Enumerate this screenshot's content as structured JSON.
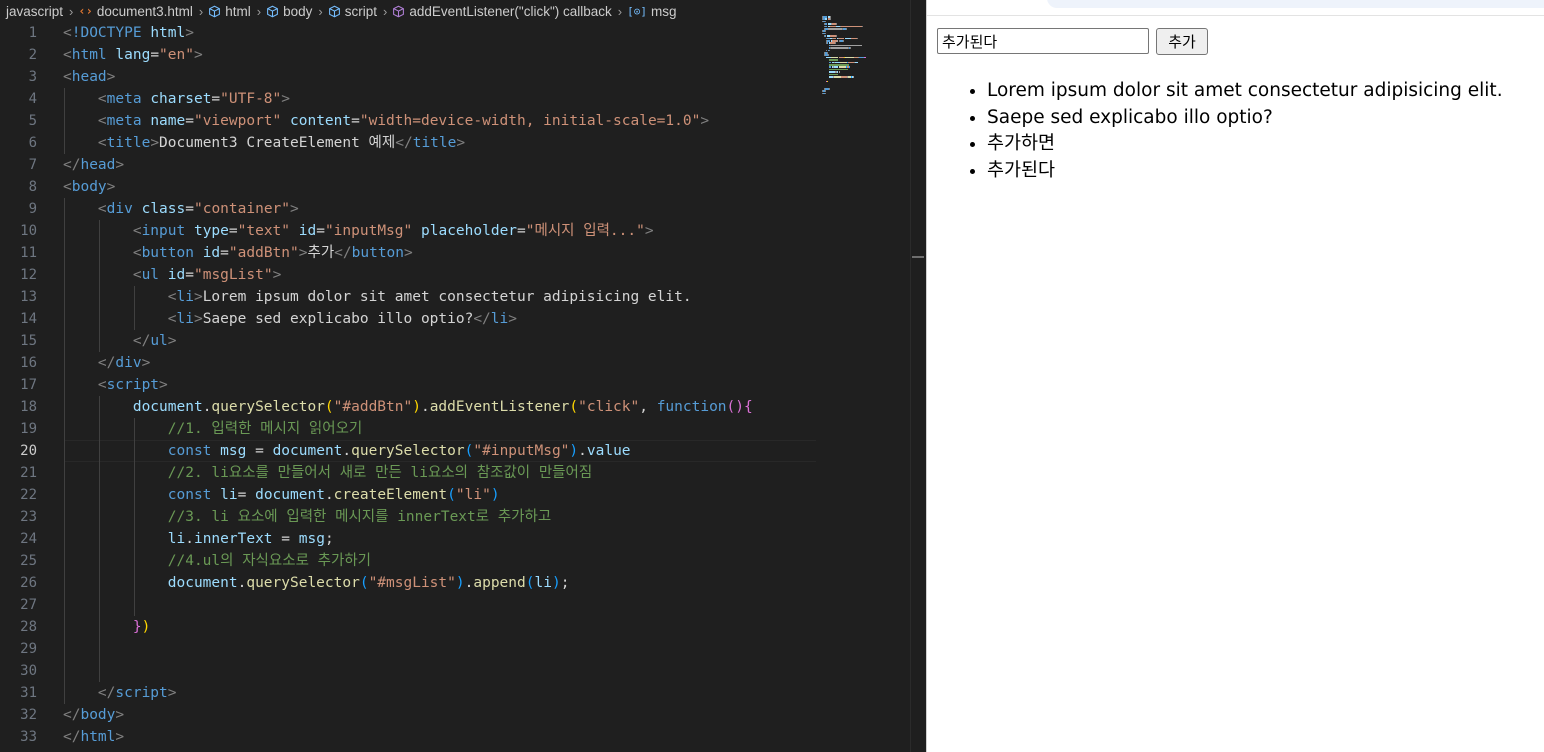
{
  "breadcrumb": {
    "items": [
      "javascript",
      "document3.html",
      "html",
      "body",
      "script",
      "addEventListener(\"click\") callback",
      "msg"
    ]
  },
  "editor": {
    "current_line": 20,
    "lines": [
      [
        [
          "<",
          "br"
        ],
        [
          "!DOCTYPE",
          "tag"
        ],
        [
          " ",
          "txt"
        ],
        [
          "html",
          "at"
        ],
        [
          ">",
          "br"
        ]
      ],
      [
        [
          "<",
          "br"
        ],
        [
          "html",
          "tag"
        ],
        [
          " ",
          "txt"
        ],
        [
          "lang",
          "at"
        ],
        [
          "=",
          "txt"
        ],
        [
          "\"en\"",
          "str"
        ],
        [
          ">",
          "br"
        ]
      ],
      [
        [
          "<",
          "br"
        ],
        [
          "head",
          "tag"
        ],
        [
          ">",
          "br"
        ]
      ],
      [
        [
          "    ",
          "txt"
        ],
        [
          "<",
          "br"
        ],
        [
          "meta",
          "tag"
        ],
        [
          " ",
          "txt"
        ],
        [
          "charset",
          "at"
        ],
        [
          "=",
          "txt"
        ],
        [
          "\"UTF-8\"",
          "str"
        ],
        [
          ">",
          "br"
        ]
      ],
      [
        [
          "    ",
          "txt"
        ],
        [
          "<",
          "br"
        ],
        [
          "meta",
          "tag"
        ],
        [
          " ",
          "txt"
        ],
        [
          "name",
          "at"
        ],
        [
          "=",
          "txt"
        ],
        [
          "\"viewport\"",
          "str"
        ],
        [
          " ",
          "txt"
        ],
        [
          "content",
          "at"
        ],
        [
          "=",
          "txt"
        ],
        [
          "\"width=device-width, initial-scale=1.0\"",
          "str"
        ],
        [
          ">",
          "br"
        ]
      ],
      [
        [
          "    ",
          "txt"
        ],
        [
          "<",
          "br"
        ],
        [
          "title",
          "tag"
        ],
        [
          ">",
          "br"
        ],
        [
          "Document3 CreateElement 예제",
          "txt"
        ],
        [
          "</",
          "br"
        ],
        [
          "title",
          "tag"
        ],
        [
          ">",
          "br"
        ]
      ],
      [
        [
          "</",
          "br"
        ],
        [
          "head",
          "tag"
        ],
        [
          ">",
          "br"
        ]
      ],
      [
        [
          "<",
          "br"
        ],
        [
          "body",
          "tag"
        ],
        [
          ">",
          "br"
        ]
      ],
      [
        [
          "    ",
          "txt"
        ],
        [
          "<",
          "br"
        ],
        [
          "div",
          "tag"
        ],
        [
          " ",
          "txt"
        ],
        [
          "class",
          "at"
        ],
        [
          "=",
          "txt"
        ],
        [
          "\"container\"",
          "str"
        ],
        [
          ">",
          "br"
        ]
      ],
      [
        [
          "        ",
          "txt"
        ],
        [
          "<",
          "br"
        ],
        [
          "input",
          "tag"
        ],
        [
          " ",
          "txt"
        ],
        [
          "type",
          "at"
        ],
        [
          "=",
          "txt"
        ],
        [
          "\"text\"",
          "str"
        ],
        [
          " ",
          "txt"
        ],
        [
          "id",
          "at"
        ],
        [
          "=",
          "txt"
        ],
        [
          "\"inputMsg\"",
          "str"
        ],
        [
          " ",
          "txt"
        ],
        [
          "placeholder",
          "at"
        ],
        [
          "=",
          "txt"
        ],
        [
          "\"메시지 입력...\"",
          "str"
        ],
        [
          ">",
          "br"
        ]
      ],
      [
        [
          "        ",
          "txt"
        ],
        [
          "<",
          "br"
        ],
        [
          "button",
          "tag"
        ],
        [
          " ",
          "txt"
        ],
        [
          "id",
          "at"
        ],
        [
          "=",
          "txt"
        ],
        [
          "\"addBtn\"",
          "str"
        ],
        [
          ">",
          "br"
        ],
        [
          "추가",
          "txt"
        ],
        [
          "</",
          "br"
        ],
        [
          "button",
          "tag"
        ],
        [
          ">",
          "br"
        ]
      ],
      [
        [
          "        ",
          "txt"
        ],
        [
          "<",
          "br"
        ],
        [
          "ul",
          "tag"
        ],
        [
          " ",
          "txt"
        ],
        [
          "id",
          "at"
        ],
        [
          "=",
          "txt"
        ],
        [
          "\"msgList\"",
          "str"
        ],
        [
          ">",
          "br"
        ]
      ],
      [
        [
          "            ",
          "txt"
        ],
        [
          "<",
          "br"
        ],
        [
          "li",
          "tag"
        ],
        [
          ">",
          "br"
        ],
        [
          "Lorem ipsum dolor sit amet consectetur adipisicing elit.",
          "txt"
        ]
      ],
      [
        [
          "            ",
          "txt"
        ],
        [
          "<",
          "br"
        ],
        [
          "li",
          "tag"
        ],
        [
          ">",
          "br"
        ],
        [
          "Saepe sed explicabo illo optio?",
          "txt"
        ],
        [
          "</",
          "br"
        ],
        [
          "li",
          "tag"
        ],
        [
          ">",
          "br"
        ]
      ],
      [
        [
          "        ",
          "txt"
        ],
        [
          "</",
          "br"
        ],
        [
          "ul",
          "tag"
        ],
        [
          ">",
          "br"
        ]
      ],
      [
        [
          "    ",
          "txt"
        ],
        [
          "</",
          "br"
        ],
        [
          "div",
          "tag"
        ],
        [
          ">",
          "br"
        ]
      ],
      [
        [
          "    ",
          "txt"
        ],
        [
          "<",
          "br"
        ],
        [
          "script",
          "tag"
        ],
        [
          ">",
          "br"
        ]
      ],
      [
        [
          "        ",
          "txt"
        ],
        [
          "document",
          "var"
        ],
        [
          ".",
          "pn"
        ],
        [
          "querySelector",
          "fn"
        ],
        [
          "(",
          "b1"
        ],
        [
          "\"#addBtn\"",
          "str"
        ],
        [
          ")",
          "b1"
        ],
        [
          ".",
          "pn"
        ],
        [
          "addEventListener",
          "fn"
        ],
        [
          "(",
          "b1"
        ],
        [
          "\"click\"",
          "str"
        ],
        [
          ", ",
          "pn"
        ],
        [
          "function",
          "kw"
        ],
        [
          "()",
          "b2"
        ],
        [
          "{",
          "b2"
        ]
      ],
      [
        [
          "            ",
          "txt"
        ],
        [
          "//1. 입력한 메시지 읽어오기",
          "cm"
        ]
      ],
      [
        [
          "            ",
          "txt"
        ],
        [
          "const",
          "kw"
        ],
        [
          " ",
          "txt"
        ],
        [
          "msg",
          "var"
        ],
        [
          " = ",
          "pn"
        ],
        [
          "document",
          "var"
        ],
        [
          ".",
          "pn"
        ],
        [
          "querySelector",
          "fn"
        ],
        [
          "(",
          "b3"
        ],
        [
          "\"#inputMsg\"",
          "str"
        ],
        [
          ")",
          "b3"
        ],
        [
          ".",
          "pn"
        ],
        [
          "value",
          "var"
        ]
      ],
      [
        [
          "            ",
          "txt"
        ],
        [
          "//2. li요소를 만들어서 새로 만든 li요소의 참조값이 만들어짐",
          "cm"
        ]
      ],
      [
        [
          "            ",
          "txt"
        ],
        [
          "const",
          "kw"
        ],
        [
          " ",
          "txt"
        ],
        [
          "li",
          "var"
        ],
        [
          "= ",
          "pn"
        ],
        [
          "document",
          "var"
        ],
        [
          ".",
          "pn"
        ],
        [
          "createElement",
          "fn"
        ],
        [
          "(",
          "b3"
        ],
        [
          "\"li\"",
          "str"
        ],
        [
          ")",
          "b3"
        ]
      ],
      [
        [
          "            ",
          "txt"
        ],
        [
          "//3. li 요소에 입력한 메시지를 innerText로 추가하고",
          "cm"
        ]
      ],
      [
        [
          "            ",
          "txt"
        ],
        [
          "li",
          "var"
        ],
        [
          ".",
          "pn"
        ],
        [
          "innerText",
          "var"
        ],
        [
          " = ",
          "pn"
        ],
        [
          "msg",
          "var"
        ],
        [
          ";",
          "pn"
        ]
      ],
      [
        [
          "            ",
          "txt"
        ],
        [
          "//4.ul의 자식요소로 추가하기",
          "cm"
        ]
      ],
      [
        [
          "            ",
          "txt"
        ],
        [
          "document",
          "var"
        ],
        [
          ".",
          "pn"
        ],
        [
          "querySelector",
          "fn"
        ],
        [
          "(",
          "b3"
        ],
        [
          "\"#msgList\"",
          "str"
        ],
        [
          ")",
          "b3"
        ],
        [
          ".",
          "pn"
        ],
        [
          "append",
          "fn"
        ],
        [
          "(",
          "b3"
        ],
        [
          "li",
          "var"
        ],
        [
          ")",
          "b3"
        ],
        [
          ";",
          "pn"
        ]
      ],
      [],
      [
        [
          "        ",
          "txt"
        ],
        [
          "}",
          "b2"
        ],
        [
          ")",
          "b1"
        ]
      ],
      [],
      [],
      [
        [
          "    ",
          "txt"
        ],
        [
          "</",
          "br"
        ],
        [
          "script",
          "tag"
        ],
        [
          ">",
          "br"
        ]
      ],
      [
        [
          "</",
          "br"
        ],
        [
          "body",
          "tag"
        ],
        [
          ">",
          "br"
        ]
      ],
      [
        [
          "</",
          "br"
        ],
        [
          "html",
          "tag"
        ],
        [
          ">",
          "br"
        ]
      ]
    ]
  },
  "browser": {
    "input_value": "추가된다",
    "input_placeholder": "메시지 입력...",
    "add_button_label": "추가",
    "list_items": [
      "Lorem ipsum dolor sit amet consectetur adipisicing elit.",
      "Saepe sed explicabo illo optio?",
      "추가하면",
      "추가된다"
    ]
  },
  "icons": {
    "breadcrumb_html": "html-file-icon",
    "breadcrumb_element": "element-cube-icon",
    "breadcrumb_method": "method-cube-icon",
    "breadcrumb_variable": "variable-icon"
  }
}
